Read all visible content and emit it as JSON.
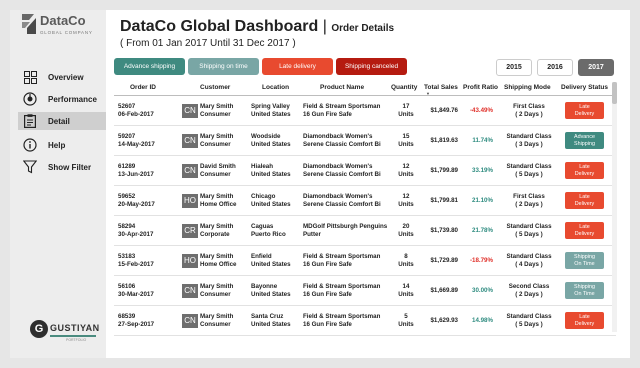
{
  "app": {
    "logo_name": "DataCo",
    "logo_sub": "GLOBAL COMPANY",
    "title": "DataCo Global Dashboard",
    "title_sep": "|",
    "subtitle": "Order Details",
    "date_range": "( From 01 Jan 2017 Until 31 Dec 2017 )"
  },
  "nav": [
    {
      "label": "Overview",
      "icon": "grid-icon"
    },
    {
      "label": "Performance",
      "icon": "gauge-icon"
    },
    {
      "label": "Detail",
      "icon": "clipboard-icon",
      "active": true
    },
    {
      "label": "Help",
      "icon": "info-icon"
    },
    {
      "label": "Show Filter",
      "icon": "funnel-icon"
    }
  ],
  "brand": {
    "letter": "G",
    "name": "GUSTIYAN",
    "sub": "PORTFOLIO"
  },
  "filters": [
    {
      "label": "Advance shipping",
      "color": "#3f8a80"
    },
    {
      "label": "Shipping on time",
      "color": "#79a6a5"
    },
    {
      "label": "Late delivery",
      "color": "#e84a2f"
    },
    {
      "label": "Shipping canceled",
      "color": "#b51b10"
    }
  ],
  "years": [
    "2015",
    "2016",
    "2017"
  ],
  "selected_year": "2017",
  "columns": [
    "Order ID",
    "Customer",
    "Location",
    "Product Name",
    "Quantity",
    "Total Sales",
    "Profit Ratio",
    "Shipping Mode",
    "Delivery Status"
  ],
  "colors": {
    "negative": "#e0302a",
    "positive": "#2f8c80",
    "late": "#e84a2f",
    "advance": "#3f8a80",
    "ontime": "#79a6a5"
  },
  "rows": [
    {
      "order_id": "52607",
      "date": "06-Feb-2017",
      "seg": "CN",
      "customer": "Mary Smith",
      "segment": "Consumer",
      "city": "Spring Valley",
      "country": "United States",
      "product1": "Field & Stream Sportsman",
      "product2": "16 Gun Fire Safe",
      "qty": "17",
      "qty_unit": "Units",
      "sales": "$1,849.76",
      "profit": "-43.49%",
      "profit_sign": "neg",
      "ship_mode": "First Class",
      "ship_days": "( 2 Days )",
      "status1": "Late",
      "status2": "Delivery",
      "status_color": "#e84a2f"
    },
    {
      "order_id": "59207",
      "date": "14-May-2017",
      "seg": "CN",
      "customer": "Mary Smith",
      "segment": "Consumer",
      "city": "Woodside",
      "country": "United States",
      "product1": "Diamondback Women's",
      "product2": "Serene Classic Comfort Bi",
      "qty": "15",
      "qty_unit": "Units",
      "sales": "$1,819.63",
      "profit": "11.74%",
      "profit_sign": "pos",
      "ship_mode": "Standard Class",
      "ship_days": "( 3 Days )",
      "status1": "Advance",
      "status2": "Shipping",
      "status_color": "#3f8a80"
    },
    {
      "order_id": "61289",
      "date": "13-Jun-2017",
      "seg": "CN",
      "customer": "David Smith",
      "segment": "Consumer",
      "city": "Hialeah",
      "country": "United States",
      "product1": "Diamondback Women's",
      "product2": "Serene Classic Comfort Bi",
      "qty": "12",
      "qty_unit": "Units",
      "sales": "$1,799.89",
      "profit": "33.19%",
      "profit_sign": "pos",
      "ship_mode": "Standard Class",
      "ship_days": "( 5 Days )",
      "status1": "Late",
      "status2": "Delivery",
      "status_color": "#e84a2f"
    },
    {
      "order_id": "59652",
      "date": "20-May-2017",
      "seg": "HO",
      "customer": "Mary Smith",
      "segment": "Home Office",
      "city": "Chicago",
      "country": "United States",
      "product1": "Diamondback Women's",
      "product2": "Serene Classic Comfort Bi",
      "qty": "12",
      "qty_unit": "Units",
      "sales": "$1,799.81",
      "profit": "21.10%",
      "profit_sign": "pos",
      "ship_mode": "First Class",
      "ship_days": "( 2 Days )",
      "status1": "Late",
      "status2": "Delivery",
      "status_color": "#e84a2f"
    },
    {
      "order_id": "58294",
      "date": "30-Apr-2017",
      "seg": "CR",
      "customer": "Mary Smith",
      "segment": "Corporate",
      "city": "Caguas",
      "country": "Puerto Rico",
      "product1": "MDGolf Pittsburgh Penguins",
      "product2": "Putter",
      "qty": "20",
      "qty_unit": "Units",
      "sales": "$1,739.80",
      "profit": "21.78%",
      "profit_sign": "pos",
      "ship_mode": "Standard Class",
      "ship_days": "( 5 Days )",
      "status1": "Late",
      "status2": "Delivery",
      "status_color": "#e84a2f"
    },
    {
      "order_id": "53183",
      "date": "15-Feb-2017",
      "seg": "HO",
      "customer": "Mary Smith",
      "segment": "Home Office",
      "city": "Enfield",
      "country": "United States",
      "product1": "Field & Stream Sportsman",
      "product2": "16 Gun Fire Safe",
      "qty": "8",
      "qty_unit": "Units",
      "sales": "$1,729.89",
      "profit": "-18.79%",
      "profit_sign": "neg",
      "ship_mode": "Standard Class",
      "ship_days": "( 4 Days )",
      "status1": "Shipping",
      "status2": "On Time",
      "status_color": "#79a6a5"
    },
    {
      "order_id": "56106",
      "date": "30-Mar-2017",
      "seg": "CN",
      "customer": "Mary Smith",
      "segment": "Consumer",
      "city": "Bayonne",
      "country": "United States",
      "product1": "Field & Stream Sportsman",
      "product2": "16 Gun Fire Safe",
      "qty": "14",
      "qty_unit": "Units",
      "sales": "$1,669.89",
      "profit": "30.00%",
      "profit_sign": "pos",
      "ship_mode": "Second Class",
      "ship_days": "( 2 Days )",
      "status1": "Shipping",
      "status2": "On Time",
      "status_color": "#79a6a5"
    },
    {
      "order_id": "68539",
      "date": "27-Sep-2017",
      "seg": "CN",
      "customer": "Mary Smith",
      "segment": "Consumer",
      "city": "Santa Cruz",
      "country": "United States",
      "product1": "Field & Stream Sportsman",
      "product2": "16 Gun Fire Safe",
      "qty": "5",
      "qty_unit": "Units",
      "sales": "$1,629.93",
      "profit": "14.98%",
      "profit_sign": "pos",
      "ship_mode": "Standard Class",
      "ship_days": "( 5 Days )",
      "status1": "Late",
      "status2": "Delivery",
      "status_color": "#e84a2f"
    }
  ]
}
